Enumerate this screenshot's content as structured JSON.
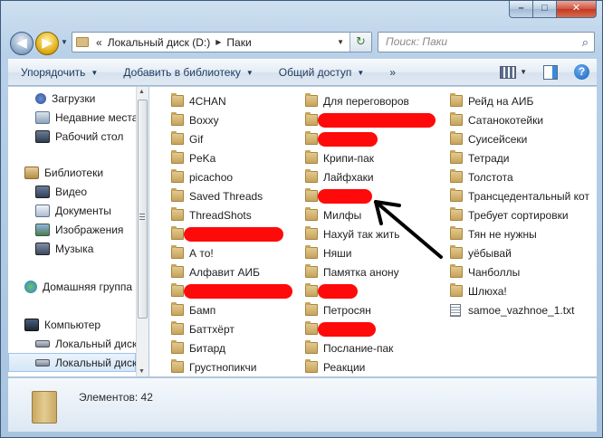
{
  "address": {
    "chevrons": "«",
    "segments": [
      "Локальный диск (D:)",
      "Паки"
    ]
  },
  "search": {
    "placeholder": "Поиск: Паки"
  },
  "toolbar": {
    "organize": "Упорядочить",
    "add_to_library": "Добавить в библиотеку",
    "share": "Общий доступ",
    "more": "»"
  },
  "nav": {
    "items": [
      {
        "label": "Загрузки",
        "icon": "downloads-icon"
      },
      {
        "label": "Недавние места",
        "icon": "recent-places-icon"
      },
      {
        "label": "Рабочий стол",
        "icon": "desktop-icon"
      },
      {
        "label": "Библиотеки",
        "icon": "libraries-icon"
      },
      {
        "label": "Видео",
        "icon": "video-library-icon"
      },
      {
        "label": "Документы",
        "icon": "documents-library-icon"
      },
      {
        "label": "Изображения",
        "icon": "pictures-library-icon"
      },
      {
        "label": "Музыка",
        "icon": "music-library-icon"
      },
      {
        "label": "Домашняя группа",
        "icon": "homegroup-icon"
      },
      {
        "label": "Компьютер",
        "icon": "computer-icon"
      },
      {
        "label": "Локальный диск",
        "icon": "local-disk-icon"
      },
      {
        "label": "Локальный диск",
        "icon": "local-disk-icon"
      }
    ]
  },
  "files": {
    "col1": [
      "4CHAN",
      "Boxxy",
      "Gif",
      "PeKa",
      "picachoo",
      "Saved Threads",
      "ThreadShots",
      "",
      "А то!",
      "Алфавит АИБ",
      "",
      "Бамп",
      "Баттхёрт",
      "Битард",
      "Грустнопикчи"
    ],
    "col2": [
      "Для переговоров",
      "",
      "",
      "Крипи-пак",
      "Лайфхаки",
      "",
      "Милфы",
      "Нахуй так жить",
      "Няши",
      "Памятка анону",
      "",
      "Петросян",
      "",
      "Послание-пак",
      "Реакции"
    ],
    "col3": [
      "Рейд на АИБ",
      "Сатанокотейки",
      "Суисейсеки",
      "Тетради",
      "Толстота",
      "Трансцедентальный кот",
      "Требует сортировки",
      "Тян не нужны",
      "уёбывай",
      "Чанболлы",
      "Шлюха!",
      "samoe_vazhnoe_1.txt"
    ]
  },
  "details": {
    "count_text": "Элементов: 42"
  },
  "colors": {
    "redaction": "#ff0a0a",
    "arrow": "#000000"
  }
}
